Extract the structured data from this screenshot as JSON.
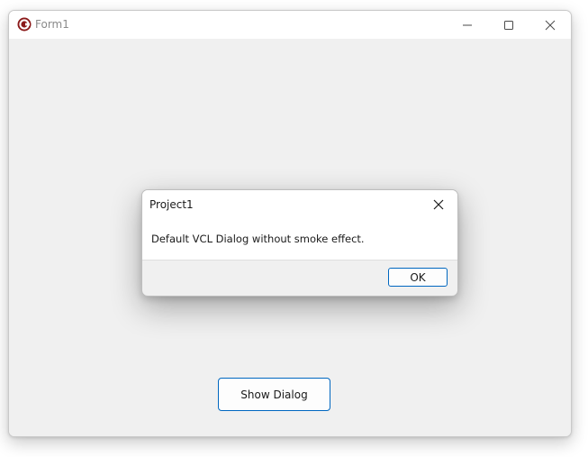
{
  "window": {
    "title": "Form1",
    "icon": "app-c-icon",
    "controls": [
      "minimize-icon",
      "maximize-icon",
      "close-icon"
    ]
  },
  "main": {
    "show_dialog_label": "Show Dialog"
  },
  "dialog": {
    "title": "Project1",
    "message": "Default VCL Dialog without smoke effect.",
    "ok_label": "OK",
    "close_icon": "close-icon"
  },
  "colors": {
    "accent": "#0067c0",
    "app_icon": "#8b1a1a",
    "client_background": "#f0f0f0"
  }
}
